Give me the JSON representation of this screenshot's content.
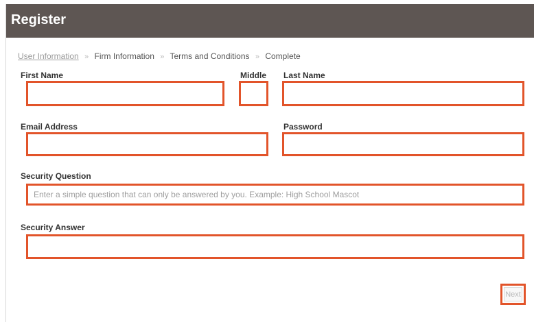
{
  "header": {
    "title": "Register"
  },
  "breadcrumb": {
    "steps": [
      "User Information",
      "Firm Information",
      "Terms and Conditions",
      "Complete"
    ],
    "separator": "»"
  },
  "form": {
    "first_name": {
      "label": "First Name",
      "value": ""
    },
    "middle": {
      "label": "Middle",
      "value": ""
    },
    "last_name": {
      "label": "Last Name",
      "value": ""
    },
    "email": {
      "label": "Email Address",
      "value": ""
    },
    "password": {
      "label": "Password",
      "value": ""
    },
    "security_question": {
      "label": "Security Question",
      "placeholder": "Enter a simple question that can only be answered by you. Example: High School Mascot",
      "value": ""
    },
    "security_answer": {
      "label": "Security Answer",
      "value": ""
    }
  },
  "actions": {
    "next_label": "Next"
  },
  "colors": {
    "header_bg": "#5e5653",
    "highlight": "#e2542a"
  }
}
